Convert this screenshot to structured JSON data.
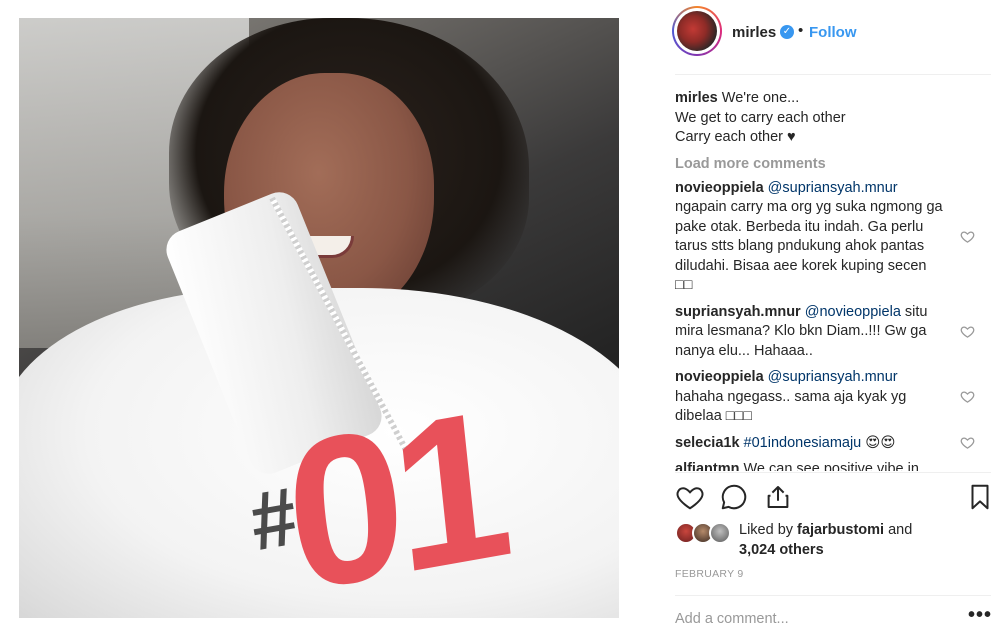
{
  "post": {
    "username": "mirles",
    "verified_mark": "✓",
    "separator": "•",
    "follow_label": "Follow",
    "caption": {
      "user": "mirles",
      "lines": [
        "We're one...",
        "We get to carry each other",
        "Carry each other ♥"
      ]
    },
    "load_more_label": "Load more comments",
    "comments": [
      {
        "user": "novieoppiela",
        "mention": "@supriansyah.mnur",
        "text": "ngapain carry ma org yg suka ngmong ga pake otak. Berbeda itu indah. Ga perlu tarus stts blang pndukung ahok pantas diludahi. Bisaa aee korek kuping secen □□"
      },
      {
        "user": "supriansyah.mnur",
        "mention": "@novieoppiela",
        "text": "situ mira lesmana? Klo bkn Diam..!!! Gw ga nanya elu... Hahaaa.."
      },
      {
        "user": "novieoppiela",
        "mention": "@supriansyah.mnur",
        "text": "hahaha ngegass.. sama aja kyak yg dibelaa □□□"
      },
      {
        "user": "selecia1k",
        "mention": "#01indonesiamaju",
        "text": "😍😍"
      },
      {
        "user": "alfiantmn",
        "mention": "",
        "text": "We can see positive vibe in"
      }
    ],
    "likes": {
      "prefix": "Liked by",
      "user": "fajarbustomi",
      "suffix": "and",
      "others": "3,024 others"
    },
    "date": "FEBRUARY 9",
    "add_comment_placeholder": "Add a comment...",
    "more_label": "•••",
    "photo_text": {
      "hash": "#",
      "number": "01"
    }
  },
  "icons": [
    "heart-icon",
    "comment-icon",
    "share-icon",
    "bookmark-icon",
    "verified-icon",
    "more-icon"
  ],
  "colors": {
    "link": "#3897f0",
    "mention": "#003569",
    "muted": "#999999",
    "text": "#262626",
    "jersey_red": "#e8515a"
  }
}
